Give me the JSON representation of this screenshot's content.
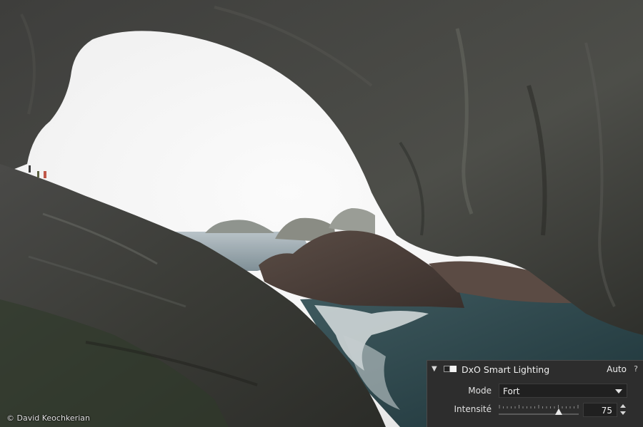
{
  "photo": {
    "credit": "© David Keochkerian"
  },
  "panel": {
    "title": "DxO Smart Lighting",
    "auto_label": "Auto",
    "help_label": "?",
    "mode_label": "Mode",
    "mode_value": "Fort",
    "intensity_label": "Intensité",
    "intensity_value": "75",
    "intensity_fraction": 0.75
  },
  "colors": {
    "panel_bg": "#2d2d2d",
    "field_bg": "#202020",
    "text": "#e8e8e8"
  }
}
